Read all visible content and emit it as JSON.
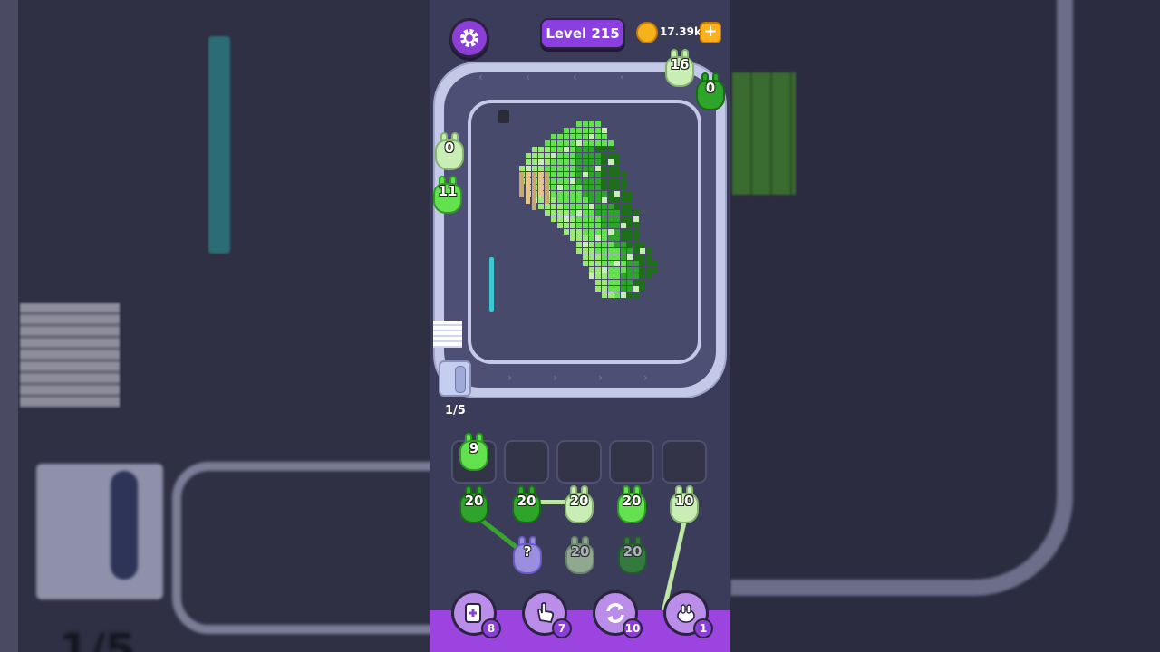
{
  "header": {
    "level_label": "Level 215",
    "coins": "17.39k",
    "add_coins_symbol": "+"
  },
  "conveyor": {
    "progress": "1/5",
    "riders": [
      {
        "count": "16",
        "color": "light"
      },
      {
        "count": "0",
        "color": "dark"
      },
      {
        "count": "0",
        "color": "light"
      },
      {
        "count": "11",
        "color": "mid"
      }
    ]
  },
  "holding_slots": {
    "filled": [
      {
        "count": "9",
        "color": "mid"
      }
    ],
    "empty_count": 4
  },
  "queue": {
    "front_row": [
      {
        "count": "20",
        "color": "dark"
      },
      {
        "count": "20",
        "color": "dark"
      },
      {
        "count": "20",
        "color": "light"
      },
      {
        "count": "20",
        "color": "mid"
      },
      {
        "count": "10",
        "color": "light"
      }
    ],
    "hidden_label": "?",
    "second_row_faded": [
      "20",
      "20"
    ]
  },
  "powerups": [
    {
      "name": "add-slot",
      "count": "8"
    },
    {
      "name": "hand",
      "count": "7"
    },
    {
      "name": "shuffle",
      "count": "10"
    },
    {
      "name": "bunny-magic",
      "count": "1"
    }
  ],
  "colors": {
    "dark_green": "#2ea52a",
    "mid_green": "#63e14f",
    "light_green": "#c9eeb5",
    "accent_purple": "#8c3fe0"
  }
}
